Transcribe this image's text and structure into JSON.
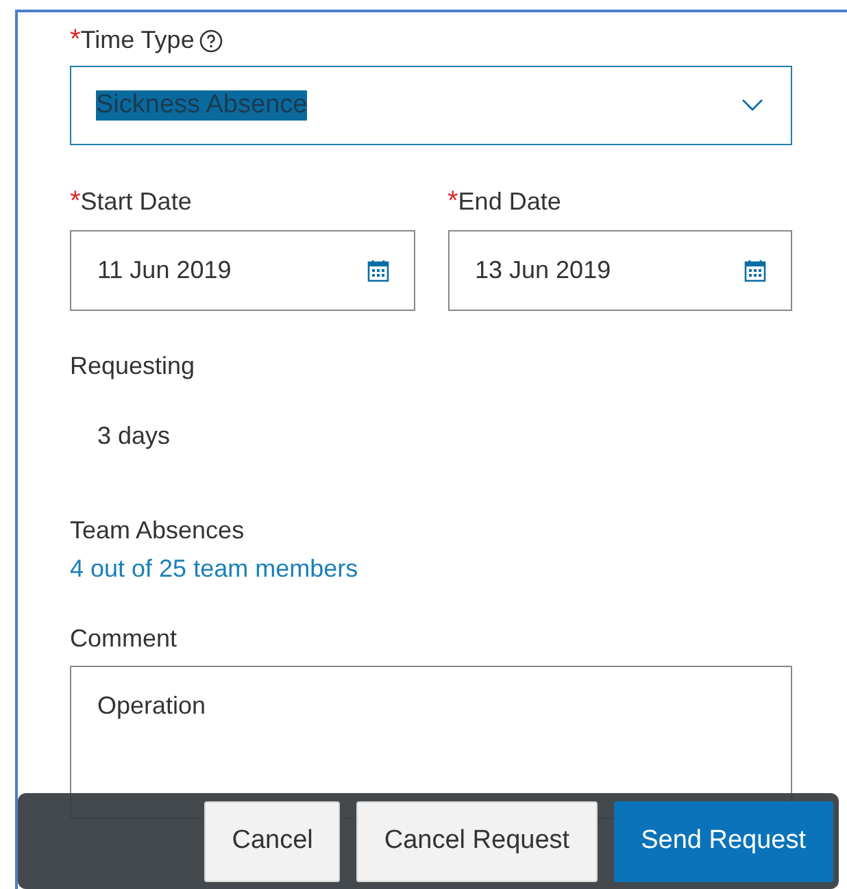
{
  "time_type": {
    "label": "Time Type",
    "required_mark": "*",
    "value": "Sickness Absence",
    "selected_text": true
  },
  "start_date": {
    "label": "Start Date",
    "required_mark": "*",
    "value": "11 Jun 2019"
  },
  "end_date": {
    "label": "End Date",
    "required_mark": "*",
    "value": "13 Jun 2019"
  },
  "requesting": {
    "label": "Requesting",
    "value": "3 days"
  },
  "team_absences": {
    "label": "Team Absences",
    "link": "4 out of 25 team members"
  },
  "comment": {
    "label": "Comment",
    "value": "Operation"
  },
  "buttons": [
    {
      "label": "Cancel",
      "kind": "secondary"
    },
    {
      "label": "Cancel Request",
      "kind": "secondary"
    },
    {
      "label": "Send Request",
      "kind": "primary"
    }
  ]
}
